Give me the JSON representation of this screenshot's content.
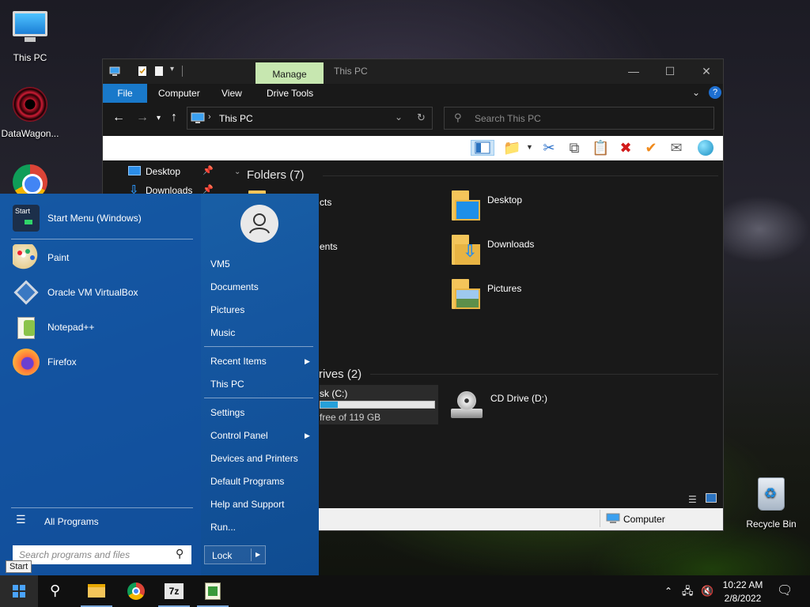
{
  "desktop": {
    "icons": [
      {
        "label": "This PC",
        "icon": "this-pc-icon"
      },
      {
        "label": "DataWagon...",
        "icon": "datawagon-icon"
      },
      {
        "label": "",
        "icon": "chrome-icon"
      },
      {
        "label": "Recycle Bin",
        "icon": "recycle-bin-icon"
      }
    ]
  },
  "explorer": {
    "title": "This PC",
    "context_tab": "Manage",
    "ribbon_tabs": [
      "File",
      "Computer",
      "View",
      "Drive Tools"
    ],
    "address": "This PC",
    "search_placeholder": "Search This PC",
    "nav_pane": [
      {
        "label": "Desktop",
        "icon": "desktop-folder-icon",
        "pinned": true
      },
      {
        "label": "Downloads",
        "icon": "downloads-arrow-icon",
        "pinned": true
      }
    ],
    "folders_header": "Folders (7)",
    "folders_visible": [
      {
        "label": "cts",
        "col": "left"
      },
      {
        "label": "ents",
        "col": "left"
      },
      {
        "label": "Desktop",
        "col": "right"
      },
      {
        "label": "Downloads",
        "col": "right"
      },
      {
        "label": "Pictures",
        "col": "right"
      }
    ],
    "drives_header": "rives (2)",
    "drives": [
      {
        "label": "sk (C:)",
        "free_text": "free of 119 GB",
        "used_fraction": 0.15
      },
      {
        "label": "CD Drive (D:)"
      }
    ],
    "bottom_status": "Computer",
    "accent_colors": {
      "manage_tab": "#c7e7b0",
      "file_tab": "#1979ca"
    }
  },
  "start_menu": {
    "pinned_apps": [
      {
        "label": "Start Menu (Windows)",
        "icon": "start-menu-app-icon"
      },
      {
        "label": "Paint",
        "icon": "paint-icon"
      },
      {
        "label": "Oracle VM VirtualBox",
        "icon": "virtualbox-icon"
      },
      {
        "label": "Notepad++",
        "icon": "notepadpp-icon"
      },
      {
        "label": "Firefox",
        "icon": "firefox-icon"
      }
    ],
    "start_app_icon_text": "Start",
    "all_programs": "All Programs",
    "search_placeholder": "Search programs and files",
    "right_items": [
      {
        "label": "VM5",
        "arrow": false
      },
      {
        "label": "Documents",
        "arrow": false
      },
      {
        "label": "Pictures",
        "arrow": false
      },
      {
        "label": "Music",
        "arrow": false
      },
      {
        "label": "Recent Items",
        "arrow": true
      },
      {
        "label": "This PC",
        "arrow": false
      },
      {
        "label": "Settings",
        "arrow": false
      },
      {
        "label": "Control Panel",
        "arrow": true
      },
      {
        "label": "Devices and Printers",
        "arrow": false
      },
      {
        "label": "Default Programs",
        "arrow": false
      },
      {
        "label": "Help and Support",
        "arrow": false
      },
      {
        "label": "Run...",
        "arrow": false
      }
    ],
    "lock_label": "Lock",
    "start_tooltip": "Start"
  },
  "taskbar": {
    "apps": [
      "file-explorer-icon",
      "chrome-icon",
      "7zip-icon",
      "app-icon"
    ],
    "sevenzip_text": "7z",
    "time": "10:22 AM",
    "date": "2/8/2022"
  }
}
